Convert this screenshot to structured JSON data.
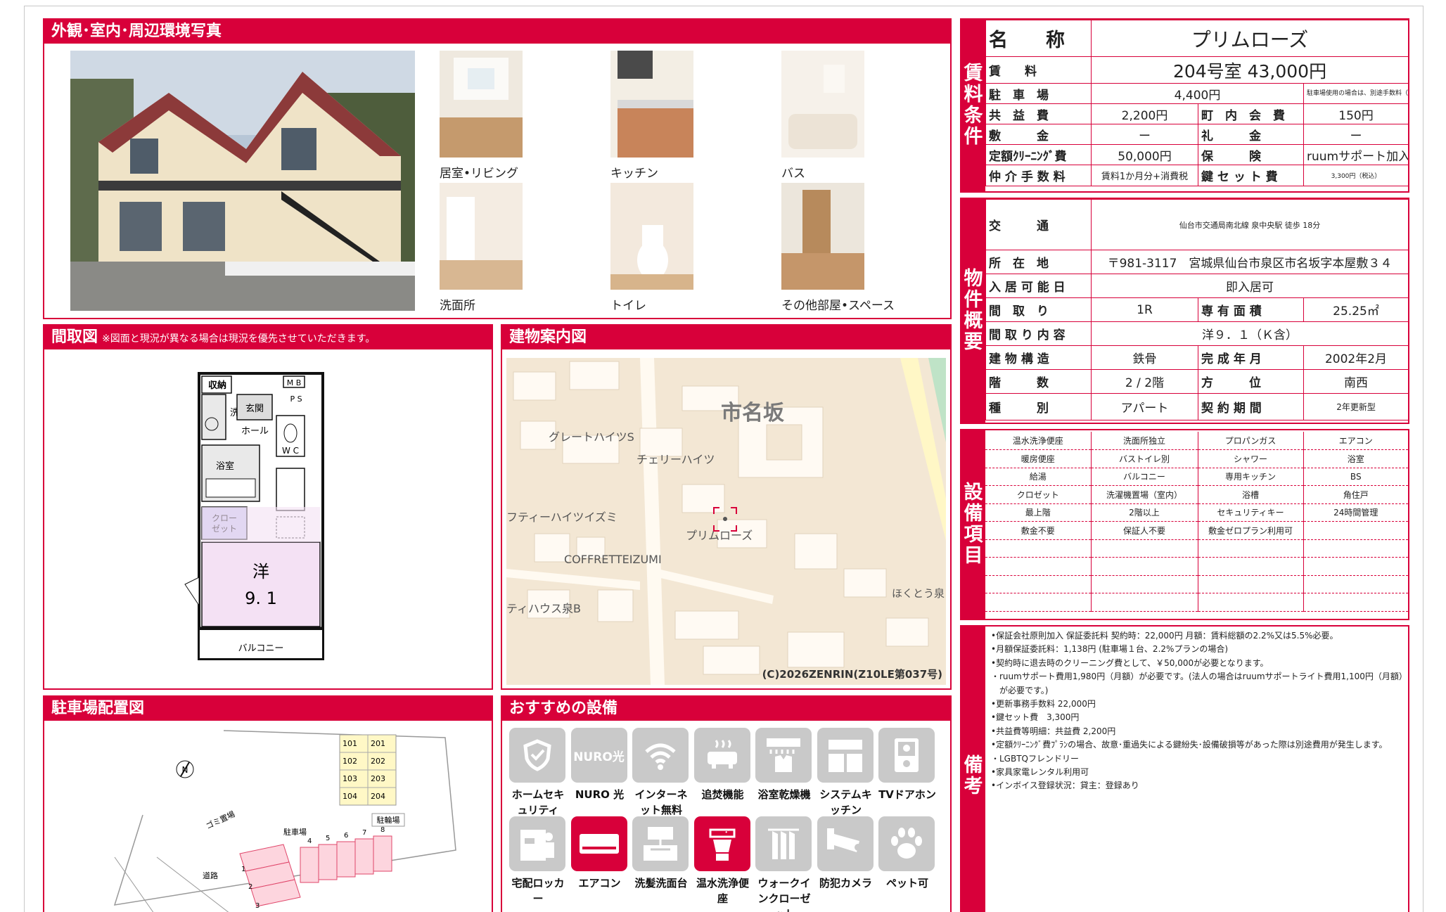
{
  "photos": {
    "title": "外観･室内･周辺環境写真",
    "captions": [
      "居室•リビング",
      "キッチン",
      "バス",
      "洗面所",
      "トイレ",
      "その他部屋•スペース"
    ]
  },
  "floorplan": {
    "title": "間取図",
    "note": "※図面と現況が異なる場合は現況を優先させていただきます。",
    "labels": {
      "storage": "収納",
      "mb": "M B",
      "ps": "P S",
      "entrance": "玄関",
      "wash": "洗面",
      "hall": "ホール",
      "wc": "W C",
      "bath": "浴室",
      "closet": "クローゼット",
      "room": "洋",
      "size": "9. 1",
      "balcony": "バルコニー"
    }
  },
  "map": {
    "title": "建物案内図",
    "labels": [
      "市名坂",
      "グレートハイツS",
      "チェリーハイツ",
      "フティーハイツイズミ",
      "プリムローズ",
      "COFFRETTEIZUMI",
      "ティハウス泉B",
      "ほくとう泉"
    ],
    "copyright": "(C)2026ZENRIN(Z10LE第037号)"
  },
  "parking": {
    "title": "駐車場配置図",
    "rooms": [
      [
        "101",
        "201"
      ],
      [
        "102",
        "202"
      ],
      [
        "103",
        "203"
      ],
      [
        "104",
        "204"
      ]
    ],
    "bicycle": "駐輪場",
    "garbage": "ゴミ置場",
    "lot": "駐車場",
    "road": "道路",
    "numbers": [
      "1",
      "2",
      "3",
      "4",
      "5",
      "6",
      "7",
      "8"
    ],
    "north": "N"
  },
  "recommended": {
    "title": "おすすめの設備",
    "items": [
      {
        "label": "ホームセキュリティ",
        "on": false,
        "icon": "shield-icon"
      },
      {
        "label": "NURO 光",
        "on": false,
        "icon": "nuro-icon",
        "text": "NURO光"
      },
      {
        "label": "インターネット無料",
        "on": false,
        "icon": "wifi-icon"
      },
      {
        "label": "追焚機能",
        "on": false,
        "icon": "bathtub-icon"
      },
      {
        "label": "浴室乾燥機",
        "on": false,
        "icon": "dryer-icon"
      },
      {
        "label": "システムキッチン",
        "on": false,
        "icon": "kitchen-icon"
      },
      {
        "label": "TVドアホン",
        "on": false,
        "icon": "intercom-icon"
      },
      {
        "label": "宅配ロッカー",
        "on": false,
        "icon": "locker-icon"
      },
      {
        "label": "エアコン",
        "on": true,
        "icon": "aircon-icon"
      },
      {
        "label": "洗髪洗面台",
        "on": false,
        "icon": "sink-icon"
      },
      {
        "label": "温水洗浄便座",
        "on": true,
        "icon": "toilet-icon"
      },
      {
        "label": "ウォークインクローゼット",
        "on": false,
        "icon": "closet-icon"
      },
      {
        "label": "防犯カメラ",
        "on": false,
        "icon": "camera-icon"
      },
      {
        "label": "ペット可",
        "on": false,
        "icon": "paw-icon"
      }
    ]
  },
  "rent": {
    "tab": "賃料条件",
    "name_label": "名　　称",
    "name": "プリムローズ",
    "rent_label": "賃　　料",
    "rent": "204号室 43,000円",
    "parking_label": "駐　車　場",
    "parking": "4,400円",
    "parking_note": "駐車場使用の場合は、別途手数料（駐車料+消費税）が必要です。",
    "common_label": "共　益　費",
    "common": "2,200円",
    "town_label": "町　内　会　費",
    "town": "150円",
    "deposit_label": "敷　　　金",
    "deposit": "ー",
    "key_money_label": "礼　　　金",
    "key_money": "ー",
    "cleaning_label": "定額ｸﾘｰﾆﾝｸﾞ費",
    "cleaning": "50,000円",
    "insurance_label": "保　　　険",
    "insurance": "ruumサポート加入時は不要",
    "brokerage_label": "仲 介 手 数 料",
    "brokerage": "賃料1か月分+消費税",
    "keyset_label": "鍵 セ ッ ト 費",
    "keyset": "3,300円（税込）"
  },
  "property": {
    "tab": "物件概要",
    "rows": [
      {
        "label": "交　　　通",
        "value": "仙台市交通局南北線 泉中央駅 徒歩 18分"
      },
      {
        "label": "所　在　地",
        "value": "〒981-3117　宮城県仙台市泉区市名坂字本屋敷３４"
      },
      {
        "label": "入 居 可 能 日",
        "value": "即入居可"
      }
    ],
    "layout_label": "間　取　り",
    "layout": "1R",
    "area_label": "専 有 面 積",
    "area": "25.25㎡",
    "detail_label": "間 取 り 内 容",
    "detail": "洋９．１（Ｋ含）",
    "structure_label": "建 物 構 造",
    "structure": "鉄骨",
    "built_label": "完 成 年 月",
    "built": "2002年2月",
    "floor_label": "階　　　数",
    "floor": "2 / 2階",
    "direction_label": "方　　　位",
    "direction": "南西",
    "type_label": "種　　　別",
    "type": "アパート",
    "contract_label": "契 約 期 間",
    "contract": "2年更新型"
  },
  "equipment": {
    "tab": "設備項目",
    "rows": [
      [
        "温水洗浄便座",
        "洗面所独立",
        "プロパンガス",
        "エアコン"
      ],
      [
        "暖房便座",
        "バストイレ別",
        "シャワー",
        "浴室"
      ],
      [
        "給湯",
        "バルコニー",
        "専用キッチン",
        "BS"
      ],
      [
        "クロゼット",
        "洗濯機置場（室内）",
        "浴槽",
        "角住戸"
      ],
      [
        "最上階",
        "2階以上",
        "セキュリティキー",
        "24時間管理"
      ],
      [
        "敷金不要",
        "保証人不要",
        "敷金ゼロプラン利用可",
        ""
      ],
      [
        "",
        "",
        "",
        ""
      ],
      [
        "",
        "",
        "",
        ""
      ],
      [
        "",
        "",
        "",
        ""
      ],
      [
        "",
        "",
        "",
        ""
      ]
    ]
  },
  "remarks": {
    "tab": "備考",
    "lines": [
      "•保証会社原則加入 保証委託料 契約時：22,000円 月額：賃料総額の2.2%又は5.5%必要。",
      "•月額保証委託料：1,138円 (駐車場１台、2.2%プランの場合)",
      "•契約時に退去時のクリーニング費として、￥50,000が必要となります。",
      "・ruumサポート費用1,980円（月額）が必要です。(法人の場合はruumサポートライト費用1,100円（月額）",
      "　が必要です。)",
      "•更新事務手数料 22,000円",
      "•鍵セット費　3,300円",
      "•共益費等明細：共益費 2,200円",
      "•定額ｸﾘｰﾆﾝｸﾞ費ﾌﾟﾗﾝの場合、故意･重過失による鍵紛失･設備破損等があった際は別途費用が発生します。",
      "・LGBTQフレンドリー",
      "•家具家電レンタル利用可",
      "•インボイス登録状況：貸主：登録あり"
    ]
  },
  "colors": {
    "accent": "#d8003a",
    "icon_off": "#c9c9c9"
  }
}
